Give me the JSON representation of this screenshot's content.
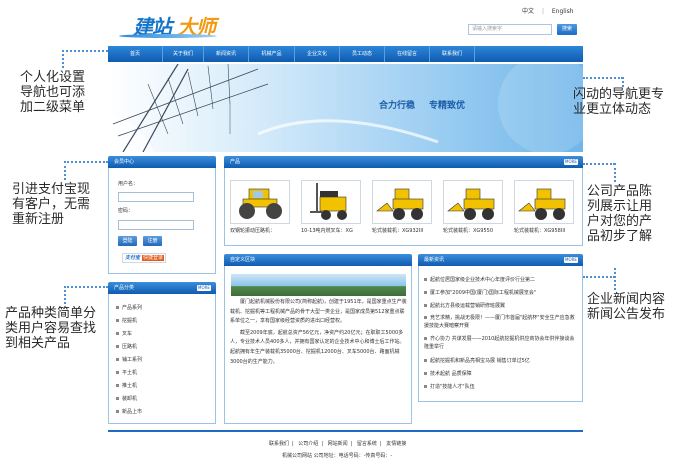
{
  "logo": {
    "part1": "建站",
    "part2": "大师"
  },
  "lang": [
    "中文",
    "English"
  ],
  "search": {
    "placeholder": "请输入搜索字",
    "button": "搜索"
  },
  "nav": [
    "首页",
    "关于我们",
    "新闻资讯",
    "机械产品",
    "企业文化",
    "员工动态",
    "在线留言",
    "联系我们"
  ],
  "banner": {
    "slogan1": "合力行稳",
    "slogan2": "专精致优"
  },
  "callouts": {
    "c1": [
      "个人化设置",
      "导航也可添",
      "加二级菜单"
    ],
    "c2": [
      "闪动的导航更专",
      "业更立体动态"
    ],
    "c3": [
      "引进支付宝现",
      "有客户，无需",
      "重新注册"
    ],
    "c4": [
      "公司产品陈",
      "列展示让用",
      "户对您的产",
      "品初步了解"
    ],
    "c5": [
      "产品种类简单分",
      "类用户容易查找",
      "到相关产品"
    ],
    "c6": [
      "企业新闻内容",
      "新闻公告发布"
    ]
  },
  "member": {
    "title": "会员中心",
    "username_label": "用户名：",
    "password_label": "密码：",
    "login": "登陆",
    "register": "注册",
    "alipay_a": "支付宝",
    "alipay_b": "快捷登录"
  },
  "categories": {
    "title": "产品分类",
    "more": "MORE",
    "items": [
      "产品系列",
      "挖掘机",
      "叉车",
      "压路机",
      "铺工系列",
      "平土机",
      "推土机",
      "装卸机",
      "新品上市"
    ]
  },
  "products": {
    "title": "产品",
    "more": "MORE",
    "items": [
      "双钢轮振动压路机：",
      "10-13吨内燃叉车：XG",
      "轮式装载机：XG932III",
      "轮式装载机：XG9550",
      "轮式装载机：XG958III"
    ]
  },
  "about": {
    "title": "自定义区块",
    "paragraphs": [
      "厦门起航机械股份有限公司(简称起航)，创建于1951年，是国家重点生产装载机、挖掘机等工程机械产品的骨干大型一类企业，是国家成员第512家重点联系单位之一，享有国家级经营资质的进出口经营权。",
      "截至2009年底，起航总资产56亿元，净资产约20亿元；在职职工5000多人，专业技术人员400多人，并拥有国家认定的企业技术中心和博士后工作站。起航拥有年生产装载机35000台、挖掘机12000台、叉车5000台、路面机械3000台的生产能力。"
    ]
  },
  "news": {
    "title": "最新资讯",
    "more": "MORE",
    "items": [
      "起航位居国家级企业技术中心年度评价行业第二",
      "厦工参加\"2009中国(厦门)国际工程机械展览会\"",
      "起航北方县级运载营销研修班展翼",
      "竞艺求精，挑战无极限！——厦门市首届\"起航杯\"安全生产应急救援技能大赛暗察开赛",
      "齐心协力 共谋发展——2010起航挖掘机供应商协会年供伴接谈会隆重举行",
      "起航挖掘机和新品亮相宝马展 销售订单过5亿",
      "技术起航  品质保障",
      "打造\"技能人才\"队伍"
    ]
  },
  "footer": {
    "links": [
      "联系我们",
      "公司介绍",
      "网站新闻",
      "留言系统",
      "友情链接"
    ],
    "address": "机械公司网站  公司地址：电话号码：-传真号码：-"
  }
}
